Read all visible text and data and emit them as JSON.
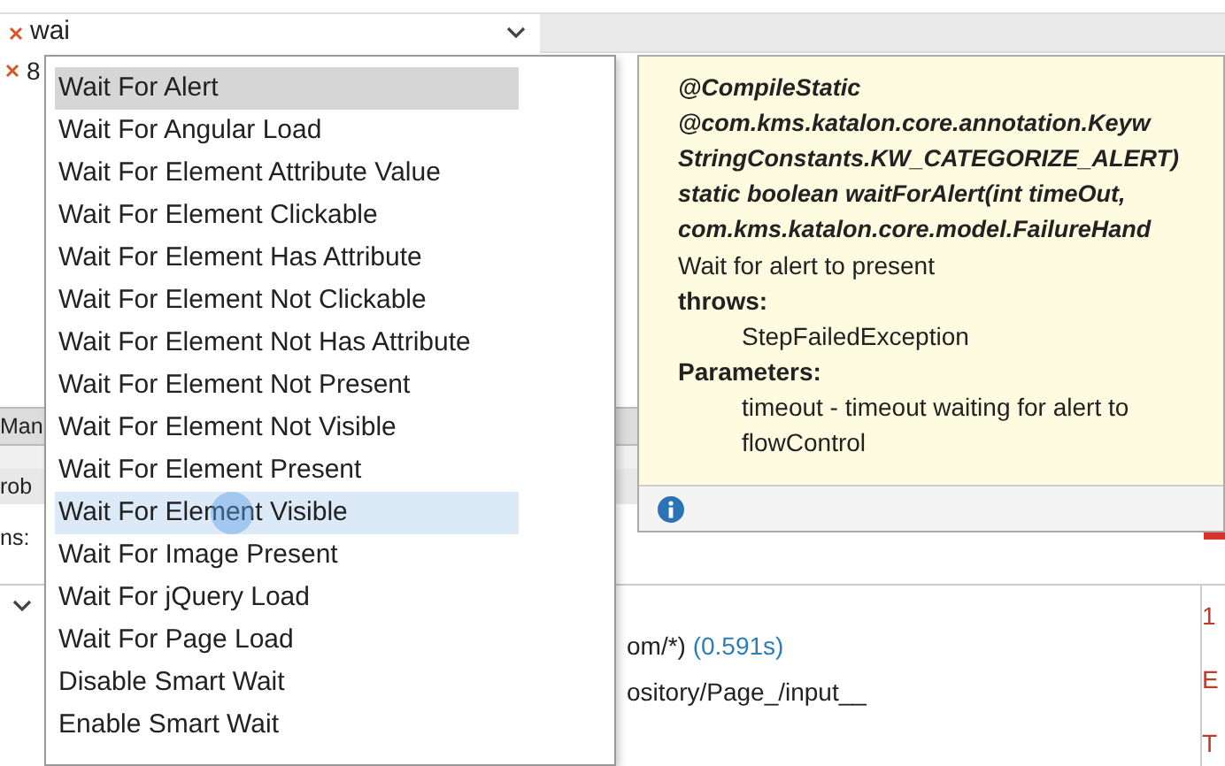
{
  "step_rows": [
    {
      "value": "wai",
      "editing": true
    },
    {
      "value": "8",
      "editing": false
    }
  ],
  "dropdown": {
    "items": [
      {
        "label": "Wait For Alert",
        "selected": true,
        "hovered": false
      },
      {
        "label": "Wait For Angular Load",
        "selected": false,
        "hovered": false
      },
      {
        "label": "Wait For Element Attribute Value",
        "selected": false,
        "hovered": false
      },
      {
        "label": "Wait For Element Clickable",
        "selected": false,
        "hovered": false
      },
      {
        "label": "Wait For Element Has Attribute",
        "selected": false,
        "hovered": false
      },
      {
        "label": "Wait For Element Not Clickable",
        "selected": false,
        "hovered": false
      },
      {
        "label": "Wait For Element Not Has Attribute",
        "selected": false,
        "hovered": false
      },
      {
        "label": "Wait For Element Not Present",
        "selected": false,
        "hovered": false
      },
      {
        "label": "Wait For Element Not Visible",
        "selected": false,
        "hovered": false
      },
      {
        "label": "Wait For Element Present",
        "selected": false,
        "hovered": false
      },
      {
        "label": "Wait For Element Visible",
        "selected": false,
        "hovered": true
      },
      {
        "label": "Wait For Image Present",
        "selected": false,
        "hovered": false
      },
      {
        "label": "Wait For jQuery Load",
        "selected": false,
        "hovered": false
      },
      {
        "label": "Wait For Page Load",
        "selected": false,
        "hovered": false
      },
      {
        "label": "Disable Smart Wait",
        "selected": false,
        "hovered": false
      },
      {
        "label": "Enable Smart Wait",
        "selected": false,
        "hovered": false
      }
    ]
  },
  "tooltip": {
    "lines": [
      {
        "kind": "signature",
        "text": "@CompileStatic"
      },
      {
        "kind": "signature",
        "text": "@com.kms.katalon.core.annotation.Keyw"
      },
      {
        "kind": "signature",
        "text": "StringConstants.KW_CATEGORIZE_ALERT)"
      },
      {
        "kind": "signature",
        "text": "static boolean waitForAlert(int timeOut,"
      },
      {
        "kind": "signature",
        "text": "com.kms.katalon.core.model.FailureHand"
      },
      {
        "kind": "text",
        "text": "Wait for alert to present"
      },
      {
        "kind": "heading",
        "text": "throws:"
      },
      {
        "kind": "detail",
        "text": "StepFailedException"
      },
      {
        "kind": "heading",
        "text": "Parameters:"
      },
      {
        "kind": "detail",
        "text": "timeout - timeout waiting for alert to"
      },
      {
        "kind": "detail",
        "text": "flowControl"
      }
    ]
  },
  "background": {
    "tab_bar": [
      "Man"
    ],
    "panel_bar": [
      "rob"
    ],
    "summary": "ns:",
    "log_lines": [
      {
        "text": "om/*)",
        "time": "(0.591s)"
      },
      {
        "text": "ository/Page_/input__"
      }
    ],
    "side_log": [
      "1",
      "E",
      "T"
    ]
  }
}
